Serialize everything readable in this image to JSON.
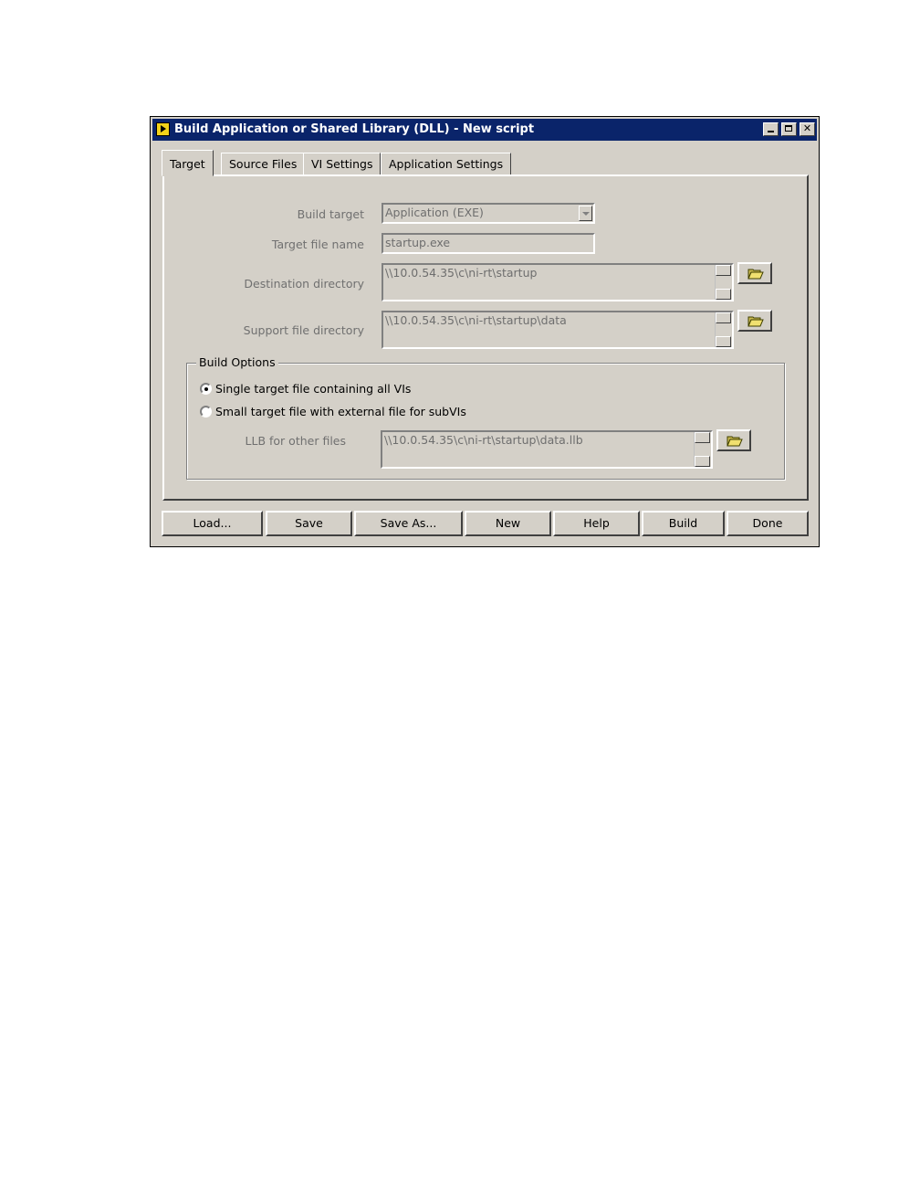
{
  "window": {
    "title": "Build Application or Shared Library (DLL) - New script",
    "icon": "labview-app-icon"
  },
  "tabs": [
    {
      "label": "Target",
      "active": true
    },
    {
      "label": "Source Files",
      "active": false
    },
    {
      "label": "VI Settings",
      "active": false
    },
    {
      "label": "Application Settings",
      "active": false
    }
  ],
  "target": {
    "build_target_label": "Build target",
    "build_target_value": "Application (EXE)",
    "target_file_name_label": "Target file name",
    "target_file_name_value": "startup.exe",
    "destination_directory_label": "Destination directory",
    "destination_directory_value": "\\\\10.0.54.35\\c\\ni-rt\\startup",
    "support_file_directory_label": "Support file directory",
    "support_file_directory_value": "\\\\10.0.54.35\\c\\ni-rt\\startup\\data"
  },
  "build_options": {
    "title": "Build Options",
    "option_single": "Single target file containing all VIs",
    "option_small": "Small target file with external file for subVIs",
    "selected": "single",
    "llb_label": "LLB for other files",
    "llb_value": "\\\\10.0.54.35\\c\\ni-rt\\startup\\data.llb"
  },
  "buttons": {
    "load": "Load...",
    "save": "Save",
    "save_as": "Save As...",
    "new": "New",
    "help": "Help",
    "build": "Build",
    "done": "Done"
  }
}
